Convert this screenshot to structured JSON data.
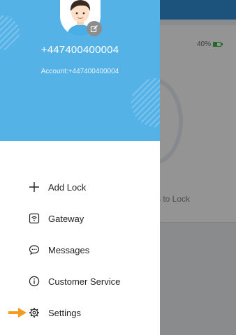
{
  "background": {
    "battery_text": "40%",
    "hint_text": "s to Lock"
  },
  "drawer": {
    "phone": "+447400400004",
    "account": "Account:+447400400004",
    "menu": [
      {
        "label": "Add Lock",
        "icon": "plus-icon"
      },
      {
        "label": "Gateway",
        "icon": "wifi-router-icon"
      },
      {
        "label": "Messages",
        "icon": "chat-bubble-icon"
      },
      {
        "label": "Customer Service",
        "icon": "info-icon"
      },
      {
        "label": "Settings",
        "icon": "gear-icon"
      }
    ]
  },
  "colors": {
    "header": "#4aaee6",
    "appbar": "#2f8fd6",
    "arrow": "#f39c1f",
    "battery": "#3bb54a"
  }
}
